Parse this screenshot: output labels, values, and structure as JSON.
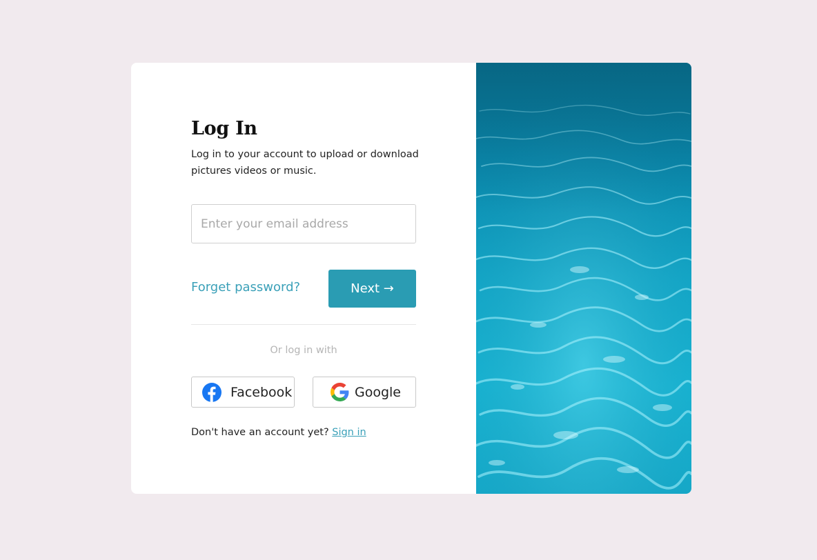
{
  "login": {
    "title": "Log In",
    "subtitle": "Log in to your account to upload or download pictures videos or music.",
    "email_placeholder": "Enter your email address",
    "email_value": "",
    "forgot_label": "Forget password?",
    "next_label": "Next →",
    "or_text": "Or log in with",
    "facebook_label": "Facebook",
    "google_label": "Google",
    "no_account_text": "Don't have an account yet?",
    "signin_label": "Sign in"
  },
  "icons": {
    "facebook": "facebook-icon",
    "google": "google-icon"
  },
  "colors": {
    "page_background": "#f1eaee",
    "accent": "#2a9cb3",
    "link": "#3aa0b8",
    "facebook_blue": "#1877f2"
  },
  "hero_image": {
    "subject": "water-surface-photo"
  }
}
